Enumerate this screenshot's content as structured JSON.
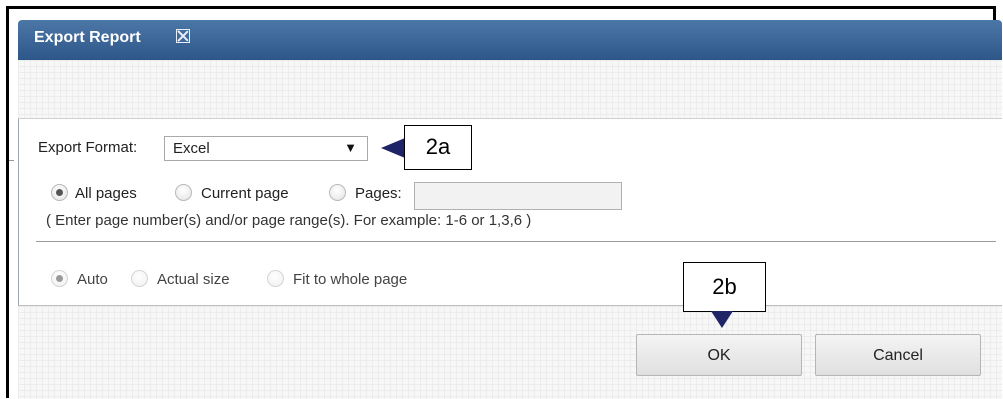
{
  "dialog": {
    "title": "Export Report"
  },
  "export_format": {
    "label": "Export Format:",
    "selected": "Excel"
  },
  "page_range": {
    "options": [
      {
        "label": "All pages",
        "checked": true
      },
      {
        "label": "Current page",
        "checked": false
      },
      {
        "label": "Pages:",
        "checked": false
      }
    ],
    "pages_value": "",
    "hint": "( Enter page number(s) and/or page range(s). For example: 1-6 or 1,3,6 )"
  },
  "sizing": {
    "options": [
      {
        "label": "Auto",
        "checked": true
      },
      {
        "label": "Actual size",
        "checked": false
      },
      {
        "label": "Fit to whole page",
        "checked": false
      }
    ]
  },
  "callouts": {
    "format": "2a",
    "ok": "2b"
  },
  "buttons": {
    "ok": "OK",
    "cancel": "Cancel"
  },
  "colors": {
    "titlebar_top": "#4b77a7",
    "titlebar_bottom": "#2e5789",
    "callout_arrow": "#1e2466"
  }
}
